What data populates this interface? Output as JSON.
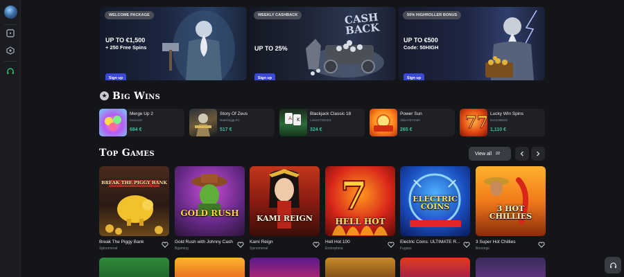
{
  "promos": [
    {
      "badge": "WELCOME PACKAGE",
      "title": "UP TO €1,500",
      "subtitle": "+ 250 Free Spins",
      "button": "Sign up"
    },
    {
      "badge": "WEEKLY CASHBACK",
      "title": "UP TO 25%",
      "subtitle": "",
      "art_text": "CASH BACK",
      "button": "Sign up"
    },
    {
      "badge": "50% HIGHROLLER BONUS",
      "title": "UP TO €500",
      "subtitle": "Code: 50HIGH",
      "button": "Sign up"
    }
  ],
  "big_wins": {
    "title": "Big Wins",
    "items": [
      {
        "game": "Merge Up 2",
        "user": "Senca18",
        "amount": "684 €"
      },
      {
        "game": "Story Of Zeus",
        "user": "NateDoggLFC",
        "amount": "517 €"
      },
      {
        "game": "Blackjack Classic 18",
        "user": "Lorenz7334411",
        "amount": "324 €"
      },
      {
        "game": "Power Sun",
        "user": "Skiier7874490",
        "amount": "265 €"
      },
      {
        "game": "Lucky Win Spins",
        "user": "Dvcs198622",
        "amount": "1,110 €"
      }
    ]
  },
  "top_games": {
    "title": "Top Games",
    "view_all": "View all",
    "count": "22",
    "items": [
      {
        "name": "Break The Piggy Bank",
        "provider": "Spinomenal",
        "art": "BREAK THE PIGGY BANK"
      },
      {
        "name": "Gold Rush with Johnny Cash",
        "provider": "Bgaming",
        "art": "GOLD RUSH"
      },
      {
        "name": "Kami Reign",
        "provider": "Spinomenal",
        "art": "KAMI REIGN"
      },
      {
        "name": "Hell Hot 100",
        "provider": "Endorphina",
        "art": "HELL HOT"
      },
      {
        "name": "Electric Coins: ULTIMATE R...",
        "provider": "Fugaso",
        "art": "ELECTRIC COINS"
      },
      {
        "name": "3 Super Hot Chillies",
        "provider": "Booongo",
        "art": "3 HOT CHILLIES"
      }
    ]
  },
  "icons": [
    "globe-logo-icon",
    "dice-icon",
    "sport-icon",
    "headset-icon",
    "star-icon",
    "chevron-left-icon",
    "chevron-right-icon",
    "heart-icon",
    "support-icon"
  ],
  "colors": {
    "background": "#141519",
    "accent": "#3a49d8",
    "win_amount": "#3fbf9b",
    "card": "#1f2026"
  }
}
